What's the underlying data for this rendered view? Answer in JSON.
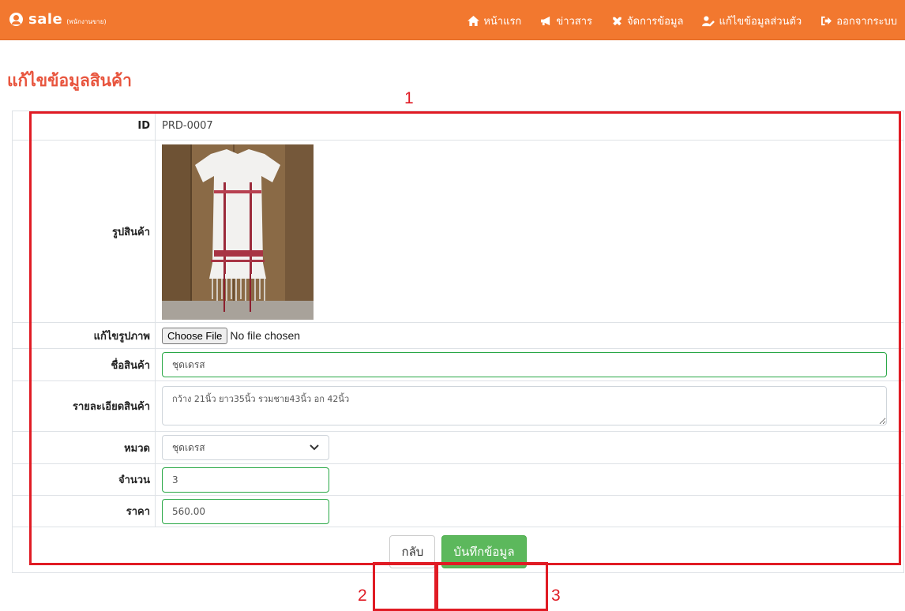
{
  "navbar": {
    "brand": "sale",
    "brand_sub": "(พนักงานขาย)",
    "items": [
      {
        "label": "หน้าแรก",
        "icon": "home-icon"
      },
      {
        "label": "ข่าวสาร",
        "icon": "megaphone-icon"
      },
      {
        "label": "จัดการข้อมูล",
        "icon": "tools-icon"
      },
      {
        "label": "แก้ไขข้อมูลส่วนตัว",
        "icon": "user-edit-icon"
      },
      {
        "label": "ออกจากระบบ",
        "icon": "sign-out-icon"
      }
    ]
  },
  "page": {
    "title": "แก้ไขข้อมูลสินค้า"
  },
  "form": {
    "id_label": "ID",
    "id_value": "PRD-0007",
    "image_label": "รูปสินค้า",
    "edit_image_label": "แก้ไขรูปภาพ",
    "file_button": "Choose File",
    "file_status": "No file chosen",
    "name_label": "ชื่อสินค้า",
    "name_value": "ชุดเดรส",
    "detail_label": "รายละเอียดสินค้า",
    "detail_value": "กว้าง 21นิ้ว ยาว35นิ้ว รวมชาย43นิ้ว อก 42นิ้ว",
    "category_label": "หมวด",
    "category_value": "ชุดเดรส",
    "quantity_label": "จำนวน",
    "quantity_value": "3",
    "price_label": "ราคา",
    "price_value": "560.00"
  },
  "buttons": {
    "back": "กลับ",
    "save": "บันทึกข้อมูล"
  },
  "annotations": {
    "a1": "1",
    "a2": "2",
    "a3": "3"
  },
  "colors": {
    "navbar": "#f2782f",
    "title": "#e8553e",
    "annotation": "#e01b24",
    "save": "#5cb85c",
    "input_border": "#28a745"
  }
}
